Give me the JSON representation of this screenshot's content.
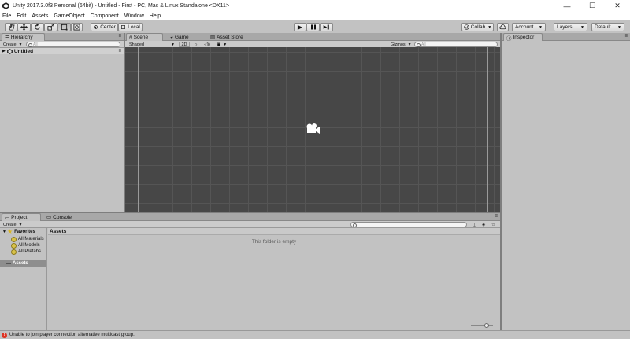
{
  "window": {
    "title": "Unity 2017.3.0f3 Personal (64bit) - Untitled - First - PC, Mac & Linux Standalone <DX11>",
    "minimize": "—",
    "maximize": "☐",
    "close": "✕"
  },
  "menu": [
    "File",
    "Edit",
    "Assets",
    "GameObject",
    "Component",
    "Window",
    "Help"
  ],
  "toolbar": {
    "tools": [
      "hand-tool-icon",
      "move-tool-icon",
      "rotate-tool-icon",
      "scale-tool-icon",
      "rect-tool-icon",
      "transform-tool-icon"
    ],
    "pivot_label": "Center",
    "space_label": "Local",
    "play": "▶",
    "pause": "❚❚",
    "step": "▶❚",
    "collab_label": "Collab",
    "account_label": "Account",
    "layers_label": "Layers",
    "layout_label": "Default"
  },
  "hierarchy": {
    "tab": "Hierarchy",
    "create_label": "Create",
    "search_placeholder": "All",
    "scene_name": "Untitled"
  },
  "scene_panel": {
    "tabs": [
      "Scene",
      "Game",
      "Asset Store"
    ],
    "shading_label": "Shaded",
    "mode_2d": "2D",
    "gizmos_label": "Gizmos",
    "search_placeholder": "All"
  },
  "inspector": {
    "tab": "Inspector"
  },
  "project": {
    "tabs": [
      "Project",
      "Console"
    ],
    "create_label": "Create",
    "favorites_label": "Favorites",
    "favorites": [
      "All Materials",
      "All Models",
      "All Prefabs"
    ],
    "assets_label": "Assets",
    "breadcrumb": "Assets",
    "empty_message": "This folder is empty"
  },
  "status": {
    "message": "Unable to join player connection alternative multicast group."
  },
  "colors": {
    "scene_bg": "#474747",
    "panel_bg": "#c2c2c2",
    "selection": "#8e8e8e"
  }
}
